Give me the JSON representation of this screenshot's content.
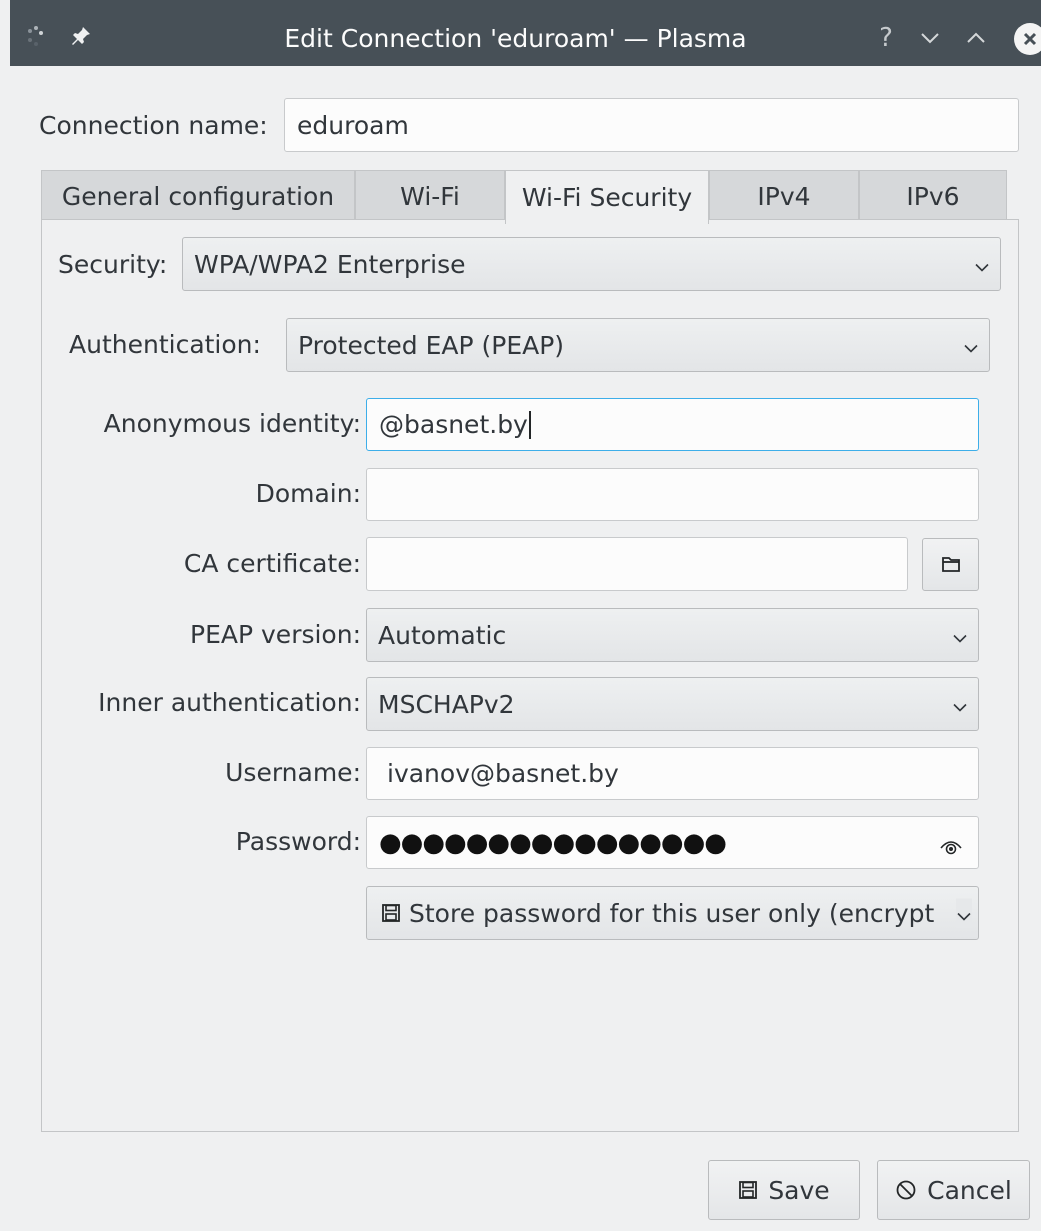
{
  "window": {
    "title": "Edit Connection 'eduroam' — Plasma",
    "titlebar_buttons": [
      "help-icon",
      "minimize-icon",
      "maximize-icon",
      "close-icon"
    ],
    "help_glyph": "?"
  },
  "connection": {
    "label": "Connection name:",
    "value": "eduroam"
  },
  "tabs": [
    {
      "label": "General configuration"
    },
    {
      "label": "Wi-Fi"
    },
    {
      "label": "Wi-Fi Security"
    },
    {
      "label": "IPv4"
    },
    {
      "label": "IPv6"
    }
  ],
  "active_tab": "Wi-Fi Security",
  "security": {
    "label": "Security:",
    "value": "WPA/WPA2 Enterprise"
  },
  "authentication": {
    "label": "Authentication:",
    "value": "Protected EAP (PEAP)"
  },
  "form": {
    "anonymous_identity": {
      "label": "Anonymous identity:",
      "value": "@basnet.by"
    },
    "domain": {
      "label": "Domain:",
      "value": ""
    },
    "ca_certificate": {
      "label": "CA certificate:",
      "value": ""
    },
    "peap_version": {
      "label": "PEAP version:",
      "value": "Automatic"
    },
    "inner_auth": {
      "label": "Inner authentication:",
      "value": "MSCHAPv2"
    },
    "username": {
      "label": "Username:",
      "value": "ivanov@basnet.by"
    },
    "password": {
      "label": "Password:",
      "value": "●●●●●●●●●●●●●●●●"
    },
    "store_password": {
      "value": "Store password for this user only (encrypt"
    }
  },
  "buttons": {
    "save": "Save",
    "cancel": "Cancel"
  },
  "colors": {
    "titlebar": "#475057",
    "focus": "#3daee9",
    "window_bg": "#eff0f1"
  }
}
